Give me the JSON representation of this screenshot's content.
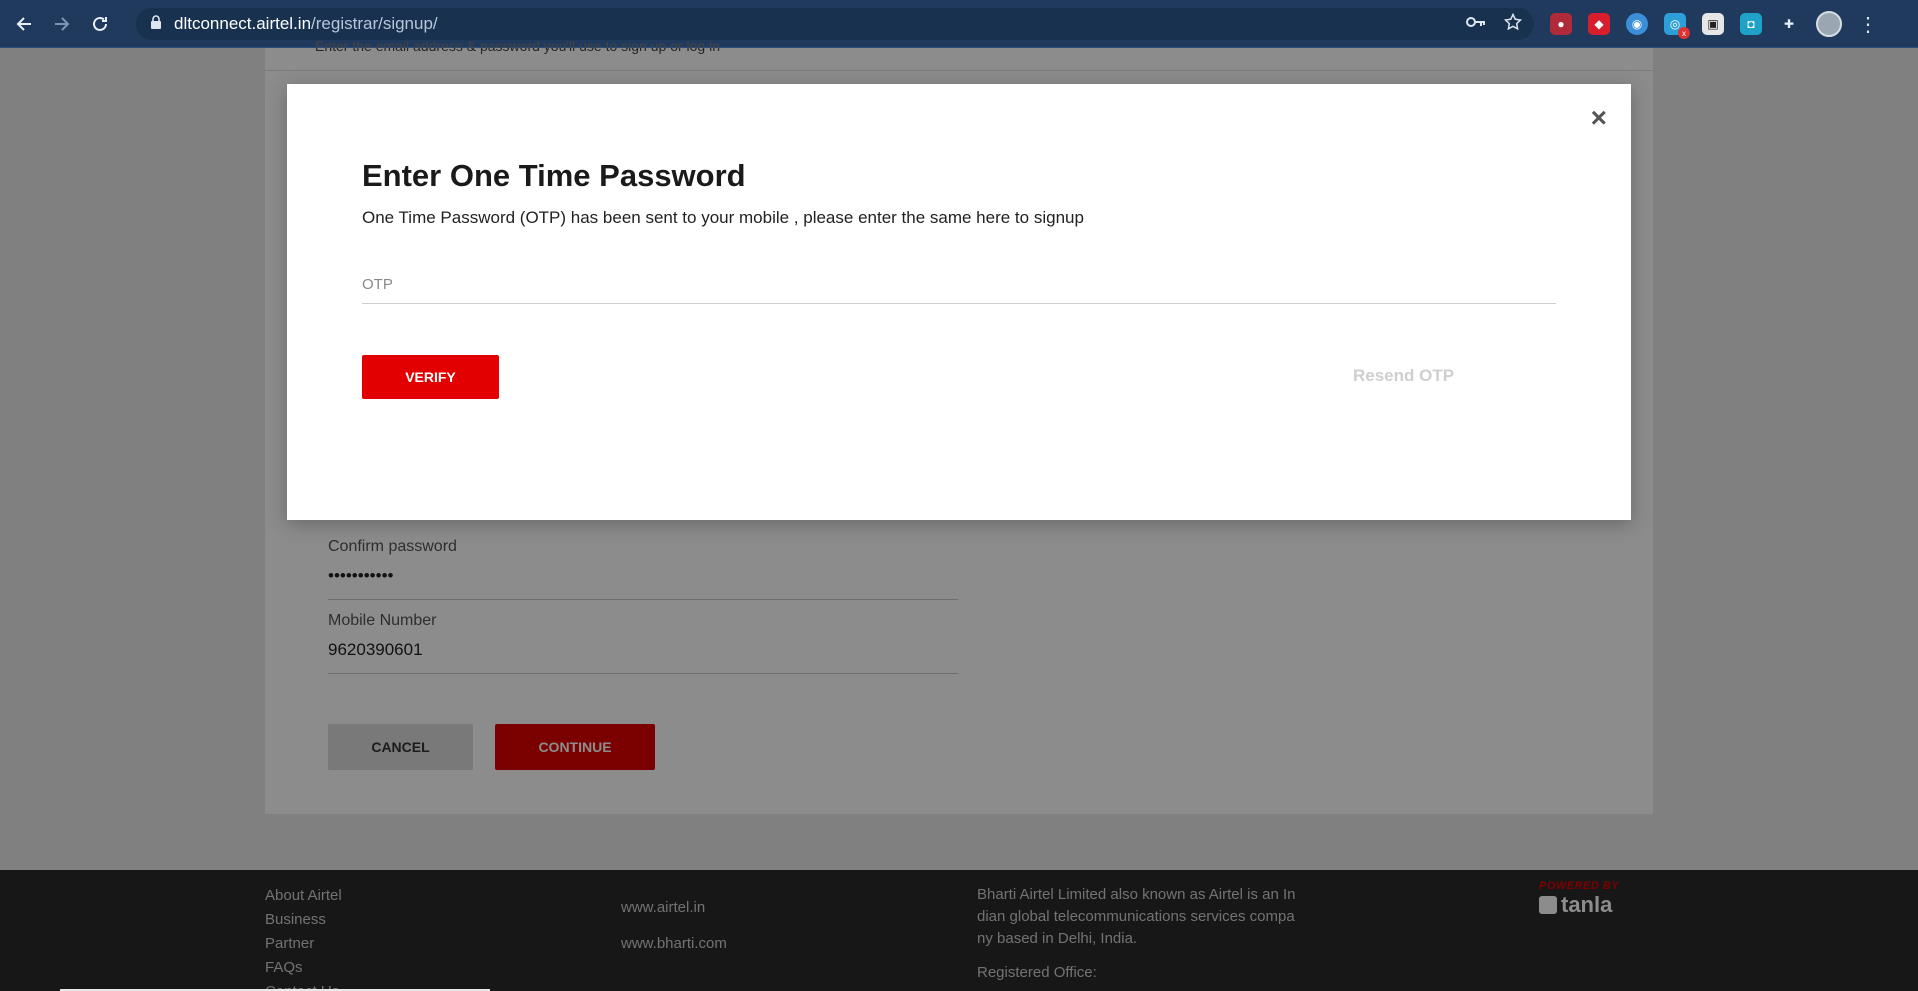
{
  "browser": {
    "url_host": "dltconnect.airtel.in",
    "url_path": "/registrar/signup/"
  },
  "page": {
    "intro_text": "Enter the email address & password you'll use to sign up or log in",
    "confirm_password_label": "Confirm password",
    "confirm_password_value": "•••••••••••",
    "mobile_label": "Mobile Number",
    "mobile_value": "9620390601",
    "cancel_label": "CANCEL",
    "continue_label": "CONTINUE"
  },
  "footer": {
    "links": [
      "About Airtel",
      "Business",
      "Partner",
      "FAQs",
      "Contact Us"
    ],
    "sites": [
      "www.airtel.in",
      "www.bharti.com"
    ],
    "about_lines": [
      "Bharti Airtel Limited also known as Airtel is an In",
      "dian global telecommunications services compa",
      "ny based in Delhi, India."
    ],
    "registered_office": "Registered Office:",
    "powered_by": "POWERED BY",
    "brand": "tanla"
  },
  "modal": {
    "title": "Enter One Time Password",
    "subtitle": "One Time Password (OTP) has been sent to your mobile , please enter the same here to signup",
    "otp_placeholder": "OTP",
    "otp_value": "",
    "verify_label": "VERIFY",
    "resend_label": "Resend OTP",
    "close_glyph": "×"
  },
  "colors": {
    "accent": "#e30000",
    "chrome": "#1f3a5c"
  }
}
